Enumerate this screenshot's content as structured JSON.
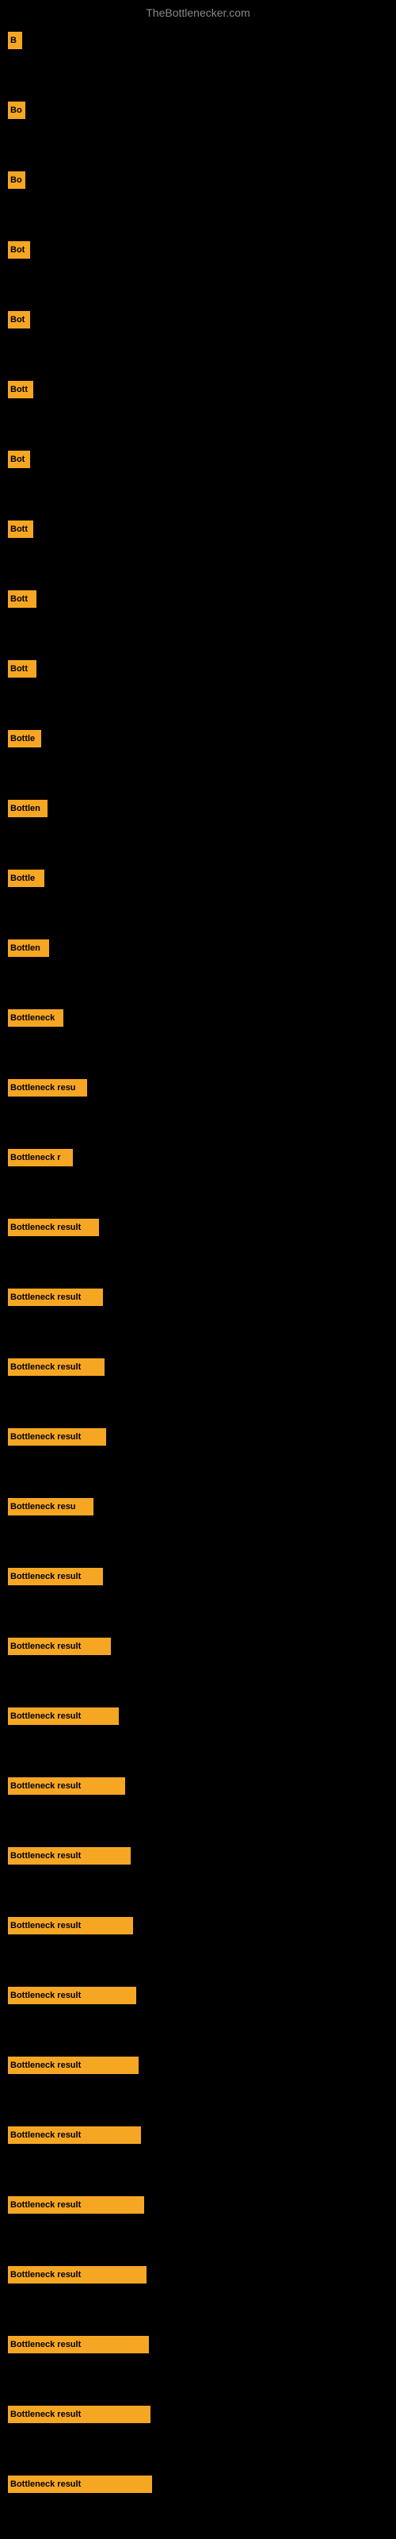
{
  "site": {
    "title": "TheBottlenecker.com"
  },
  "bars": [
    {
      "label": "B",
      "width": 18
    },
    {
      "label": "Bo",
      "width": 22
    },
    {
      "label": "Bo",
      "width": 22
    },
    {
      "label": "Bot",
      "width": 28
    },
    {
      "label": "Bot",
      "width": 28
    },
    {
      "label": "Bott",
      "width": 32
    },
    {
      "label": "Bot",
      "width": 28
    },
    {
      "label": "Bott",
      "width": 32
    },
    {
      "label": "Bott",
      "width": 36
    },
    {
      "label": "Bott",
      "width": 36
    },
    {
      "label": "Bottle",
      "width": 42
    },
    {
      "label": "Bottlen",
      "width": 50
    },
    {
      "label": "Bottle",
      "width": 46
    },
    {
      "label": "Bottlen",
      "width": 52
    },
    {
      "label": "Bottleneck",
      "width": 70
    },
    {
      "label": "Bottleneck resu",
      "width": 100
    },
    {
      "label": "Bottleneck r",
      "width": 82
    },
    {
      "label": "Bottleneck result",
      "width": 115
    },
    {
      "label": "Bottleneck result",
      "width": 120
    },
    {
      "label": "Bottleneck result",
      "width": 122
    },
    {
      "label": "Bottleneck result",
      "width": 124
    },
    {
      "label": "Bottleneck resu",
      "width": 108
    },
    {
      "label": "Bottleneck result",
      "width": 120
    },
    {
      "label": "Bottleneck result",
      "width": 130
    },
    {
      "label": "Bottleneck result",
      "width": 140
    },
    {
      "label": "Bottleneck result",
      "width": 148
    },
    {
      "label": "Bottleneck result",
      "width": 155
    },
    {
      "label": "Bottleneck result",
      "width": 158
    },
    {
      "label": "Bottleneck result",
      "width": 162
    },
    {
      "label": "Bottleneck result",
      "width": 165
    },
    {
      "label": "Bottleneck result",
      "width": 168
    },
    {
      "label": "Bottleneck result",
      "width": 172
    },
    {
      "label": "Bottleneck result",
      "width": 175
    },
    {
      "label": "Bottleneck result",
      "width": 178
    },
    {
      "label": "Bottleneck result",
      "width": 180
    },
    {
      "label": "Bottleneck result",
      "width": 182
    }
  ]
}
